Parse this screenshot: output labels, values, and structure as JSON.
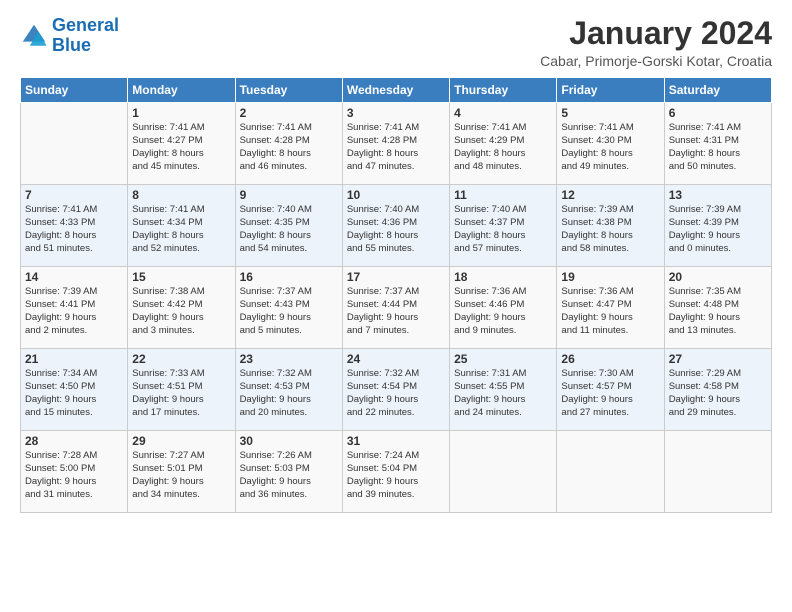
{
  "logo": {
    "text_general": "General",
    "text_blue": "Blue"
  },
  "header": {
    "title": "January 2024",
    "subtitle": "Cabar, Primorje-Gorski Kotar, Croatia"
  },
  "columns": [
    "Sunday",
    "Monday",
    "Tuesday",
    "Wednesday",
    "Thursday",
    "Friday",
    "Saturday"
  ],
  "weeks": [
    [
      {
        "day": "",
        "info": ""
      },
      {
        "day": "1",
        "info": "Sunrise: 7:41 AM\nSunset: 4:27 PM\nDaylight: 8 hours\nand 45 minutes."
      },
      {
        "day": "2",
        "info": "Sunrise: 7:41 AM\nSunset: 4:28 PM\nDaylight: 8 hours\nand 46 minutes."
      },
      {
        "day": "3",
        "info": "Sunrise: 7:41 AM\nSunset: 4:28 PM\nDaylight: 8 hours\nand 47 minutes."
      },
      {
        "day": "4",
        "info": "Sunrise: 7:41 AM\nSunset: 4:29 PM\nDaylight: 8 hours\nand 48 minutes."
      },
      {
        "day": "5",
        "info": "Sunrise: 7:41 AM\nSunset: 4:30 PM\nDaylight: 8 hours\nand 49 minutes."
      },
      {
        "day": "6",
        "info": "Sunrise: 7:41 AM\nSunset: 4:31 PM\nDaylight: 8 hours\nand 50 minutes."
      }
    ],
    [
      {
        "day": "7",
        "info": "Sunrise: 7:41 AM\nSunset: 4:33 PM\nDaylight: 8 hours\nand 51 minutes."
      },
      {
        "day": "8",
        "info": "Sunrise: 7:41 AM\nSunset: 4:34 PM\nDaylight: 8 hours\nand 52 minutes."
      },
      {
        "day": "9",
        "info": "Sunrise: 7:40 AM\nSunset: 4:35 PM\nDaylight: 8 hours\nand 54 minutes."
      },
      {
        "day": "10",
        "info": "Sunrise: 7:40 AM\nSunset: 4:36 PM\nDaylight: 8 hours\nand 55 minutes."
      },
      {
        "day": "11",
        "info": "Sunrise: 7:40 AM\nSunset: 4:37 PM\nDaylight: 8 hours\nand 57 minutes."
      },
      {
        "day": "12",
        "info": "Sunrise: 7:39 AM\nSunset: 4:38 PM\nDaylight: 8 hours\nand 58 minutes."
      },
      {
        "day": "13",
        "info": "Sunrise: 7:39 AM\nSunset: 4:39 PM\nDaylight: 9 hours\nand 0 minutes."
      }
    ],
    [
      {
        "day": "14",
        "info": "Sunrise: 7:39 AM\nSunset: 4:41 PM\nDaylight: 9 hours\nand 2 minutes."
      },
      {
        "day": "15",
        "info": "Sunrise: 7:38 AM\nSunset: 4:42 PM\nDaylight: 9 hours\nand 3 minutes."
      },
      {
        "day": "16",
        "info": "Sunrise: 7:37 AM\nSunset: 4:43 PM\nDaylight: 9 hours\nand 5 minutes."
      },
      {
        "day": "17",
        "info": "Sunrise: 7:37 AM\nSunset: 4:44 PM\nDaylight: 9 hours\nand 7 minutes."
      },
      {
        "day": "18",
        "info": "Sunrise: 7:36 AM\nSunset: 4:46 PM\nDaylight: 9 hours\nand 9 minutes."
      },
      {
        "day": "19",
        "info": "Sunrise: 7:36 AM\nSunset: 4:47 PM\nDaylight: 9 hours\nand 11 minutes."
      },
      {
        "day": "20",
        "info": "Sunrise: 7:35 AM\nSunset: 4:48 PM\nDaylight: 9 hours\nand 13 minutes."
      }
    ],
    [
      {
        "day": "21",
        "info": "Sunrise: 7:34 AM\nSunset: 4:50 PM\nDaylight: 9 hours\nand 15 minutes."
      },
      {
        "day": "22",
        "info": "Sunrise: 7:33 AM\nSunset: 4:51 PM\nDaylight: 9 hours\nand 17 minutes."
      },
      {
        "day": "23",
        "info": "Sunrise: 7:32 AM\nSunset: 4:53 PM\nDaylight: 9 hours\nand 20 minutes."
      },
      {
        "day": "24",
        "info": "Sunrise: 7:32 AM\nSunset: 4:54 PM\nDaylight: 9 hours\nand 22 minutes."
      },
      {
        "day": "25",
        "info": "Sunrise: 7:31 AM\nSunset: 4:55 PM\nDaylight: 9 hours\nand 24 minutes."
      },
      {
        "day": "26",
        "info": "Sunrise: 7:30 AM\nSunset: 4:57 PM\nDaylight: 9 hours\nand 27 minutes."
      },
      {
        "day": "27",
        "info": "Sunrise: 7:29 AM\nSunset: 4:58 PM\nDaylight: 9 hours\nand 29 minutes."
      }
    ],
    [
      {
        "day": "28",
        "info": "Sunrise: 7:28 AM\nSunset: 5:00 PM\nDaylight: 9 hours\nand 31 minutes."
      },
      {
        "day": "29",
        "info": "Sunrise: 7:27 AM\nSunset: 5:01 PM\nDaylight: 9 hours\nand 34 minutes."
      },
      {
        "day": "30",
        "info": "Sunrise: 7:26 AM\nSunset: 5:03 PM\nDaylight: 9 hours\nand 36 minutes."
      },
      {
        "day": "31",
        "info": "Sunrise: 7:24 AM\nSunset: 5:04 PM\nDaylight: 9 hours\nand 39 minutes."
      },
      {
        "day": "",
        "info": ""
      },
      {
        "day": "",
        "info": ""
      },
      {
        "day": "",
        "info": ""
      }
    ]
  ]
}
